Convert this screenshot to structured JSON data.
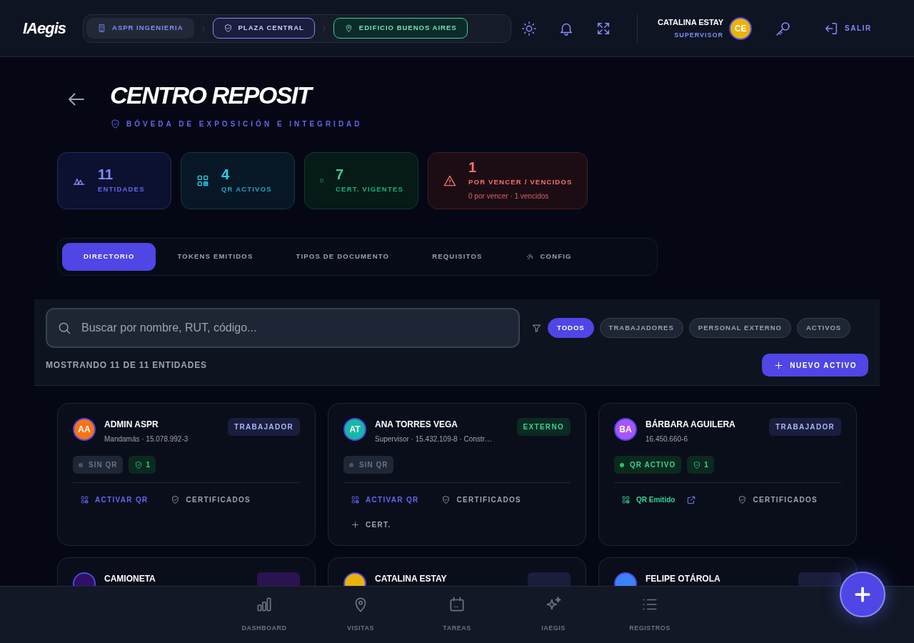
{
  "header": {
    "logo": "IAegis",
    "breadcrumbs": [
      {
        "label": "ASPR INGENIERIA",
        "kind": "building",
        "selected": false
      },
      {
        "label": "PLAZA CENTRAL",
        "kind": "shield",
        "selected": false
      },
      {
        "label": "EDIFICIO BUENOS AIRES",
        "kind": "pin",
        "selected": true
      }
    ],
    "user": {
      "name": "CATALINA ESTAY",
      "role": "SUPERVISOR",
      "initials": "CE"
    },
    "logout": "SALIR"
  },
  "page": {
    "title": "CENTRO REPOSIT",
    "subtitle": "BÓVEDA DE EXPOSICIÓN E INTEGRIDAD"
  },
  "stats": [
    {
      "value": "11",
      "label": "ENTIDADES"
    },
    {
      "value": "4",
      "label": "QR ACTIVOS"
    },
    {
      "value": "7",
      "label": "CERT. VIGENTES"
    },
    {
      "value": "1",
      "label": "POR VENCER / VENCIDOS",
      "sub": "0 por vencer · 1 vencidos"
    }
  ],
  "tabs": [
    {
      "label": "DIRECTORIO",
      "selected": true
    },
    {
      "label": "TOKENS EMITIDOS",
      "selected": false
    },
    {
      "label": "TIPOS DE DOCUMENTO",
      "selected": false
    },
    {
      "label": "REQUISITOS",
      "selected": false
    },
    {
      "label": "CONFIG",
      "selected": false
    }
  ],
  "search": {
    "placeholder": "Buscar por nombre, RUT, código..."
  },
  "filters": [
    {
      "label": "TODOS",
      "selected": true
    },
    {
      "label": "TRABAJADORES",
      "selected": false
    },
    {
      "label": "PERSONAL EXTERNO",
      "selected": false
    },
    {
      "label": "ACTIVOS",
      "selected": false
    }
  ],
  "count_text": "MOSTRANDO **11** DE **11** ENTIDADES",
  "new_button": "NUEVO ACTIVO",
  "entities": [
    {
      "initials": "AA",
      "color": "#f97316",
      "name": "ADMIN ASPR",
      "detail": "Mandamás · 15.078.992-3",
      "type": {
        "label": "TRABAJADOR",
        "kind": "worker"
      },
      "qr": {
        "label": "SIN QR",
        "active": false
      },
      "certs": "1",
      "actions": [
        {
          "kind": "activate",
          "label": "ACTIVAR QR"
        },
        {
          "kind": "certs",
          "label": "CERTIFICADOS"
        }
      ]
    },
    {
      "initials": "AT",
      "color": "#14b8a6",
      "name": "ANA TORRES VEGA",
      "detail": "Supervisor · 15.432.109-8 · Constr…",
      "type": {
        "label": "EXTERNO",
        "kind": "external"
      },
      "qr": {
        "label": "SIN QR",
        "active": false
      },
      "actions": [
        {
          "kind": "activate",
          "label": "ACTIVAR QR"
        },
        {
          "kind": "certs",
          "label": "CERTIFICADOS"
        },
        {
          "kind": "add",
          "label": "CERT."
        }
      ]
    },
    {
      "initials": "BA",
      "color": "#a855f7",
      "name": "BÁRBARA AGUILERA",
      "detail": "16.450.660-6",
      "type": {
        "label": "TRABAJADOR",
        "kind": "worker"
      },
      "qr": {
        "label": "QR ACTIVO",
        "active": true
      },
      "certs": "1",
      "actions": [
        {
          "kind": "issued",
          "label": "QR Emitido"
        },
        {
          "kind": "certs",
          "label": "CERTIFICADOS"
        }
      ]
    },
    {
      "color": "#2e1065",
      "name": "CAMIONETA",
      "type": {
        "kind": "vehicle"
      }
    },
    {
      "color": "#eab308",
      "name": "CATALINA ESTAY",
      "type": {
        "kind": "worker"
      }
    },
    {
      "color": "#3b82f6",
      "name": "FELIPE OTÁROLA",
      "type": {
        "kind": "worker"
      }
    }
  ],
  "bottom_nav": [
    {
      "label": "DASHBOARD"
    },
    {
      "label": "VISITAS"
    },
    {
      "label": "TAREAS"
    },
    {
      "label": "IAEGIS"
    },
    {
      "label": "REGISTROS"
    }
  ]
}
